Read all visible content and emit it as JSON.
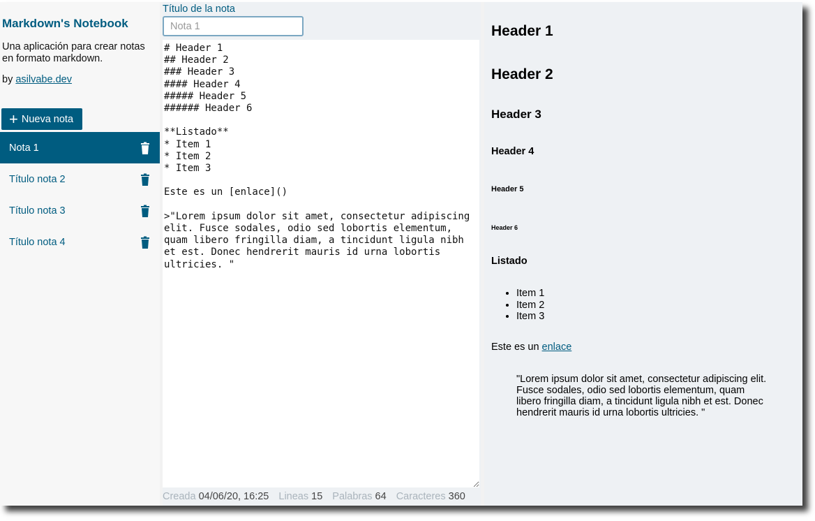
{
  "sidebar": {
    "title": "Markdown's Notebook",
    "description": "Una aplicación para crear notas en formato markdown.",
    "by_prefix": "by",
    "author_link": "asilvabe.dev",
    "new_note_label": "Nueva nota",
    "notes": [
      {
        "title": "Nota 1",
        "active": true
      },
      {
        "title": "Título nota 2",
        "active": false
      },
      {
        "title": "Título nota 3",
        "active": false
      },
      {
        "title": "Título nota 4",
        "active": false
      }
    ]
  },
  "editor": {
    "title_label": "Título de la nota",
    "title_placeholder": "Nota 1",
    "content": "# Header 1\n## Header 2\n### Header 3\n#### Header 4\n##### Header 5\n###### Header 6\n\n**Listado**\n* Item 1\n* Item 2\n* Item 3\n\nEste es un [enlace]()\n\n>\"Lorem ipsum dolor sit amet, consectetur adipiscing elit. Fusce sodales, odio sed lobortis elementum, quam libero fringilla diam, a tincidunt ligula nibh et est. Donec hendrerit mauris id urna lobortis ultricies. \""
  },
  "status": {
    "created_label": "Creada",
    "created_value": "04/06/20, 16:25",
    "lines_label": "Lineas",
    "lines_value": "15",
    "words_label": "Palabras",
    "words_value": "64",
    "chars_label": "Caracteres",
    "chars_value": "360"
  },
  "preview": {
    "h1": "Header 1",
    "h2": "Header 2",
    "h3": "Header 3",
    "h4": "Header 4",
    "h5": "Header 5",
    "h6": "Header 6",
    "list_title": "Listado",
    "items": [
      "Item 1",
      "Item 2",
      "Item 3"
    ],
    "para_prefix": "Este es un",
    "link_text": "enlace",
    "quote": "\"Lorem ipsum dolor sit amet, consectetur adipiscing elit. Fusce sodales, odio sed lobortis elementum, quam libero fringilla diam, a tincidunt ligula nibh et est. Donec hendrerit mauris id urna lobortis ultricies. \""
  },
  "colors": {
    "accent": "#005c80",
    "sidebar_bg": "#f7f7f7",
    "panel_bg": "#eef1f4"
  }
}
